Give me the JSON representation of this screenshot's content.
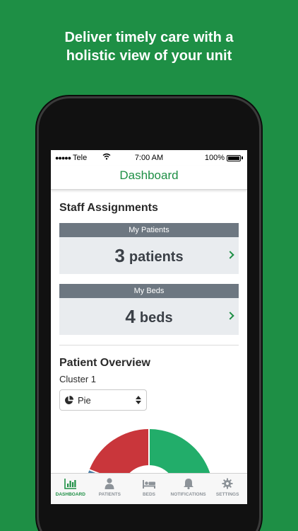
{
  "headline": {
    "line1": "Deliver timely care with a",
    "line2": "holistic view of your unit"
  },
  "status_bar": {
    "carrier": "Tele",
    "time": "7:00 AM",
    "battery": "100%"
  },
  "nav": {
    "title": "Dashboard"
  },
  "staff_assignments": {
    "title": "Staff Assignments",
    "cards": [
      {
        "header": "My Patients",
        "count": "3",
        "unit": "patients"
      },
      {
        "header": "My Beds",
        "count": "4",
        "unit": "beds"
      }
    ]
  },
  "patient_overview": {
    "title": "Patient Overview",
    "cluster": "Cluster 1",
    "chart_type_select": "Pie"
  },
  "colors": {
    "brand_green": "#1e8f45",
    "slice_green": "#22ad6a",
    "slice_red": "#c9363b",
    "slice_blue": "#4b7fa8"
  },
  "tabs": [
    {
      "label": "DASHBOARD",
      "icon": "bar-chart-icon",
      "active": true
    },
    {
      "label": "PATIENTS",
      "icon": "person-icon",
      "active": false
    },
    {
      "label": "BEDS",
      "icon": "bed-icon",
      "active": false
    },
    {
      "label": "NOTIFICATIONS",
      "icon": "bell-icon",
      "active": false
    },
    {
      "label": "SETTINGS",
      "icon": "gear-icon",
      "active": false
    }
  ]
}
